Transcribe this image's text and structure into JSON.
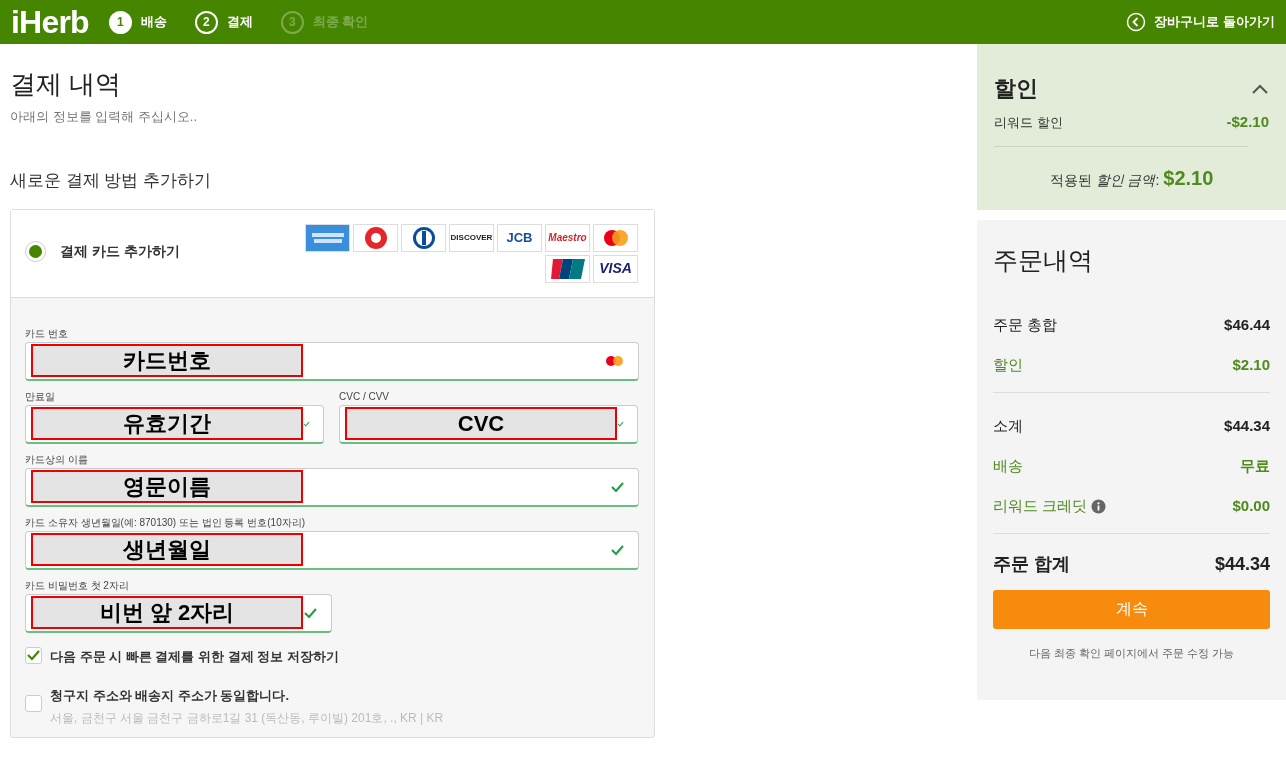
{
  "header": {
    "logo": "iHerb",
    "steps": [
      {
        "number": "1",
        "label": "배송",
        "completed": true,
        "disabled": false
      },
      {
        "number": "2",
        "label": "결제",
        "completed": false,
        "disabled": false
      },
      {
        "number": "3",
        "label": "최종 확인",
        "completed": false,
        "disabled": true
      }
    ],
    "back_link": "장바구니로 돌아가기"
  },
  "payment": {
    "title": "결제 내역",
    "subtitle": "아래의 정보를 입력해 주십시오..",
    "section_title": "새로운 결제 방법 추가하기",
    "card_option": {
      "label": "결제 카드 추가하기",
      "selected": true
    },
    "card_logos": [
      {
        "kind": "amex"
      },
      {
        "kind": "bc"
      },
      {
        "kind": "diners"
      },
      {
        "kind": "discover",
        "label": "DISCOVER"
      },
      {
        "kind": "jcb",
        "label": "JCB"
      },
      {
        "kind": "maestro",
        "label": "Maestro"
      },
      {
        "kind": "mastercard"
      },
      {
        "kind": "unionpay"
      },
      {
        "kind": "visa",
        "label": "VISA"
      }
    ],
    "fields": [
      {
        "label": "카드 번호",
        "annotation": "카드번호",
        "valid": false,
        "card_icon": true,
        "half": false
      },
      {
        "label": "만료일",
        "annotation": "유효기간",
        "valid": true,
        "half": true
      },
      {
        "label": "CVC / CVV",
        "annotation": "CVC",
        "valid": true,
        "half": true
      },
      {
        "label": "카드상의 이름",
        "annotation": "영문이름",
        "valid": true,
        "half": false
      },
      {
        "label": "카드 소유자 생년월일(예: 870130) 또는 법인 등록 번호(10자리)",
        "annotation": "생년월일",
        "valid": true,
        "half": false
      },
      {
        "label": "카드 비밀번호 첫 2자리",
        "annotation": "비번 앞 2자리",
        "valid": true,
        "half": true
      }
    ],
    "checkboxes": [
      {
        "label": "다음 주문 시 빠른 결제를 위한 결제 정보 저장하기",
        "checked": true
      },
      {
        "label": "청구지 주소와 배송지 주소가 동일합니다.",
        "detail": "서울, 금천구 서울 금천구 금하로1길 31 (독산동, 루이빌) 201호, ., KR | KR",
        "checked": false
      }
    ]
  },
  "discount": {
    "title": "할인",
    "expanded": true,
    "rows": [
      {
        "label": "리워드 할인",
        "value": "-$2.10"
      }
    ],
    "applied_label": "적용된 *할인 금액*:",
    "applied_value": "$2.10"
  },
  "summary": {
    "title": "주문내역",
    "sections": [
      [
        {
          "label": "주문 총합",
          "value": "$46.44",
          "highlight": false
        },
        {
          "label": "할인",
          "value": "$2.10",
          "highlight": true
        }
      ],
      [
        {
          "label": "소계",
          "value": "$44.34",
          "highlight": false
        },
        {
          "label": "배송",
          "value": "무료",
          "highlight": true
        },
        {
          "label": "리워드 크레딧",
          "value": "$0.00",
          "highlight": true,
          "info": true
        }
      ]
    ],
    "total_label": "주문 합계",
    "total_value": "$44.34",
    "button": "계속",
    "note": "다음 최종 확인 페이지에서 주문 수정 가능"
  }
}
